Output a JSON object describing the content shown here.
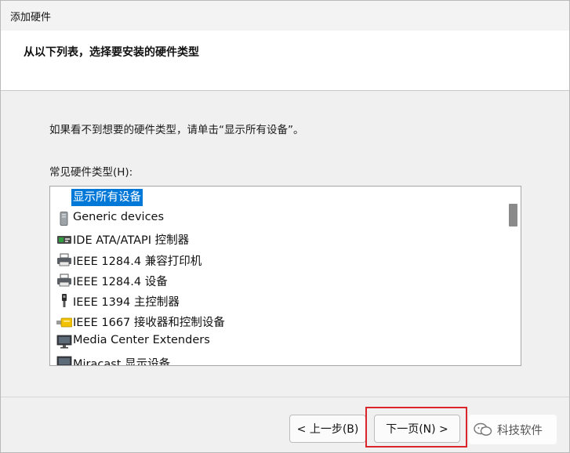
{
  "window": {
    "title": "添加硬件",
    "heading": "从以下列表，选择要安装的硬件类型"
  },
  "content": {
    "instruction": "如果看不到想要的硬件类型，请单击“显示所有设备”。",
    "list_label": "常见硬件类型(H):",
    "items": [
      {
        "label": "显示所有设备",
        "icon": "none",
        "selected": true
      },
      {
        "label": "Generic devices",
        "icon": "generic-device-icon"
      },
      {
        "label": "IDE ATA/ATAPI 控制器",
        "icon": "ide-controller-icon"
      },
      {
        "label": "IEEE 1284.4 兼容打印机",
        "icon": "printer-icon"
      },
      {
        "label": "IEEE 1284.4 设备",
        "icon": "printer-icon"
      },
      {
        "label": "IEEE 1394 主控制器",
        "icon": "firewire-plug-icon"
      },
      {
        "label": "IEEE 1667 接收器和控制设备",
        "icon": "usb-drive-icon"
      },
      {
        "label": "Media Center Extenders",
        "icon": "monitor-icon"
      },
      {
        "label": "Miracast 显示设备",
        "icon": "monitor-icon"
      }
    ]
  },
  "footer": {
    "back_label": "< 上一步(B)",
    "next_label": "下一页(N) >"
  },
  "watermark": {
    "text": "科技软件"
  },
  "colors": {
    "selection": "#0078d7",
    "highlight_border": "#d9262b"
  }
}
